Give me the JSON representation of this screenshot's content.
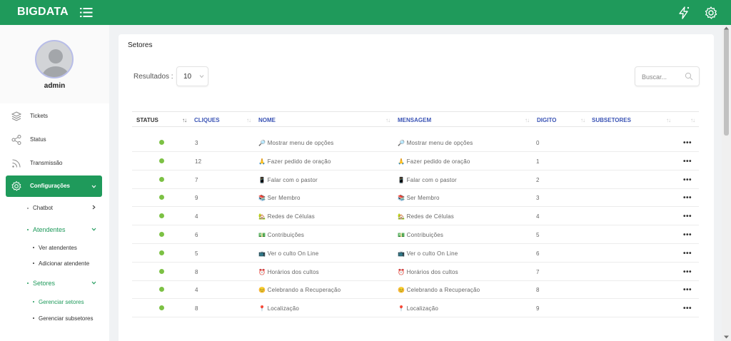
{
  "app": {
    "brand": "BIGDATA"
  },
  "user": {
    "name": "admin"
  },
  "sidebar": {
    "items": [
      {
        "label": "Tickets",
        "icon": "layers-icon"
      },
      {
        "label": "Status",
        "icon": "share-icon"
      },
      {
        "label": "Transmissão",
        "icon": "rss-icon"
      },
      {
        "label": "Configurações",
        "icon": "gear-icon"
      }
    ],
    "sub": {
      "chatbot": "Chatbot",
      "atendentes": "Atendentes",
      "ver_atendentes": "Ver atendentes",
      "adicionar_atendente": "Adicionar atendente",
      "setores": "Setores",
      "gerenciar_setores": "Gerenciar setores",
      "gerenciar_subsetores": "Gerenciar subsetores"
    }
  },
  "page": {
    "title": "Setores",
    "results_label": "Resultados :",
    "results_value": "10",
    "search_placeholder": "Buscar..."
  },
  "table": {
    "headers": [
      "STATUS",
      "CLIQUES",
      "NOME",
      "MENSAGEM",
      "DIGITO",
      "SUBSETORES"
    ],
    "sort_glyph": "↑↓",
    "more_glyph": "•••",
    "rows": [
      {
        "cliques": "3",
        "emoji": "🔎",
        "nome": "Mostrar menu de opções",
        "mensagem": "Mostrar menu de opções",
        "digito": "0"
      },
      {
        "cliques": "12",
        "emoji": "🙏",
        "nome": "Fazer pedido de oração",
        "mensagem": "Fazer pedido de oração",
        "digito": "1"
      },
      {
        "cliques": "7",
        "emoji": "📱",
        "nome": "Falar com o pastor",
        "mensagem": "Falar com o pastor",
        "digito": "2"
      },
      {
        "cliques": "9",
        "emoji": "📚",
        "nome": "Ser Membro",
        "mensagem": "Ser Membro",
        "digito": "3"
      },
      {
        "cliques": "4",
        "emoji": "🏡",
        "nome": "Redes de Células",
        "mensagem": "Redes de Células",
        "digito": "4"
      },
      {
        "cliques": "6",
        "emoji": "💵",
        "nome": "Contribuições",
        "mensagem": "Contribuições",
        "digito": "5"
      },
      {
        "cliques": "5",
        "emoji": "📺",
        "nome": "Ver o culto On Line",
        "mensagem": "Ver o culto On Line",
        "digito": "6"
      },
      {
        "cliques": "8",
        "emoji": "⏰",
        "nome": "Horários dos cultos",
        "mensagem": "Horários dos cultos",
        "digito": "7"
      },
      {
        "cliques": "4",
        "emoji": "😊",
        "nome": "Celebrando a Recuperação",
        "mensagem": "Celebrando a Recuperação",
        "digito": "8"
      },
      {
        "cliques": "8",
        "emoji": "📍",
        "nome": "Localização",
        "mensagem": "Localização",
        "digito": "9"
      }
    ]
  },
  "colors": {
    "brand": "#1f9a5b",
    "header_link": "#3b54b5",
    "status_active": "#7cc144"
  }
}
